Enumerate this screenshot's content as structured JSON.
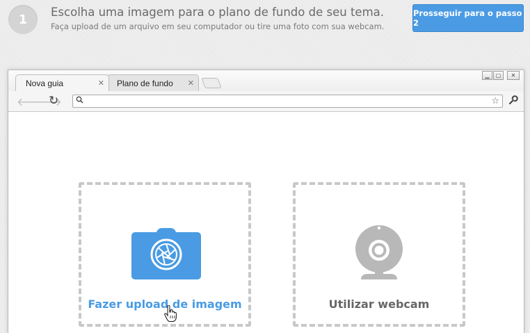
{
  "step": {
    "number": "1",
    "title": "Escolha uma imagem para o plano de fundo de seu tema.",
    "subtitle": "Faça upload de um arquivo em seu computador ou tire uma foto com sua webcam.",
    "next_button": "Prosseguir para o passo 2"
  },
  "browser": {
    "tabs": [
      {
        "label": "Nova guia",
        "active": true
      },
      {
        "label": "Plano de fundo",
        "active": false
      }
    ],
    "omnibox": {
      "value": "",
      "placeholder": ""
    },
    "icons": {
      "back": "arrow-left-icon",
      "forward": "arrow-right-icon",
      "reload": "reload-icon",
      "search": "search-icon",
      "star": "star-icon",
      "wrench": "wrench-icon"
    }
  },
  "options": {
    "upload": {
      "label": "Fazer upload de imagem",
      "icon": "camera-icon"
    },
    "webcam": {
      "label": "Utilizar webcam",
      "icon": "webcam-icon"
    }
  },
  "colors": {
    "accent": "#4a9be3",
    "dashed_border": "#c8c8c8",
    "webcam_gray": "#b8b8b8",
    "muted_text": "#666666"
  }
}
